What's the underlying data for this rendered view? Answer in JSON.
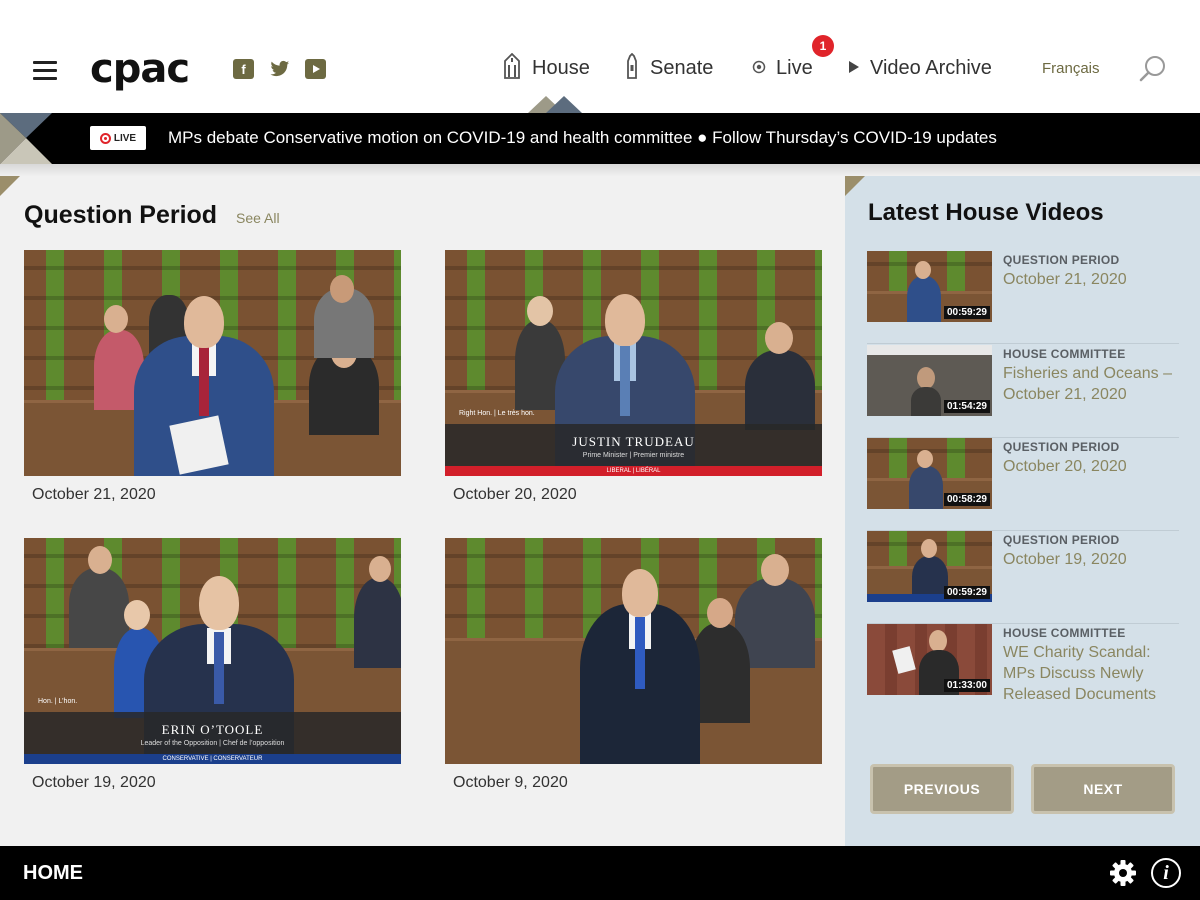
{
  "header": {
    "logo": "cpac",
    "social": [
      {
        "icon": "facebook-icon",
        "glyph": "f"
      },
      {
        "icon": "twitter-icon",
        "glyph": "ὂ6"
      },
      {
        "icon": "youtube-icon",
        "glyph": "▶"
      }
    ],
    "nav": {
      "house": "House",
      "senate": "Senate",
      "live": "Live",
      "archive": "Video Archive"
    },
    "live_badge": "1",
    "language": "Français"
  },
  "ticker": {
    "live_label": "LIVE",
    "text": "MPs debate Conservative motion on COVID-19 and health committee ● Follow Thursday’s COVID-19 updates"
  },
  "question_period": {
    "title": "Question Period",
    "see_all": "See All",
    "videos": [
      {
        "date": "October 21, 2020"
      },
      {
        "date": "October 20, 2020",
        "caption_honor": "Right Hon.  |  Le très hon.",
        "caption_name": "JUSTIN TRUDEAU",
        "caption_role": "Prime Minister   |   Premier ministre",
        "caption_party": "LIBERAL | LIBÉRAL"
      },
      {
        "date": "October 19, 2020",
        "caption_honor": "Hon.  |  L’hon.",
        "caption_name": "ERIN O’TOOLE",
        "caption_role": "Leader of the Opposition   |   Chef de l’opposition",
        "caption_party": "CONSERVATIVE | CONSERVATEUR"
      },
      {
        "date": "October 9, 2020"
      }
    ]
  },
  "sidebar": {
    "title": "Latest House Videos",
    "items": [
      {
        "category": "Question Period",
        "name": "October 21, 2020",
        "duration": "00:59:29"
      },
      {
        "category": "House Committee",
        "name": "Fisheries and Oceans – October 21, 2020",
        "duration": "01:54:29"
      },
      {
        "category": "Question Period",
        "name": "October 20, 2020",
        "duration": "00:58:29"
      },
      {
        "category": "Question Period",
        "name": "October 19, 2020",
        "duration": "00:59:29"
      },
      {
        "category": "House Committee",
        "name": "WE Charity Scandal: MPs Discuss Newly Released Documents",
        "duration": "01:33:00"
      }
    ],
    "previous": "PREVIOUS",
    "next": "NEXT"
  },
  "footer": {
    "home": "HOME"
  },
  "colors": {
    "accent_olive": "#8a8660",
    "sidebar_bg": "#d4e0e8",
    "button_bg": "#a39c86",
    "live_red": "#e0242a"
  }
}
